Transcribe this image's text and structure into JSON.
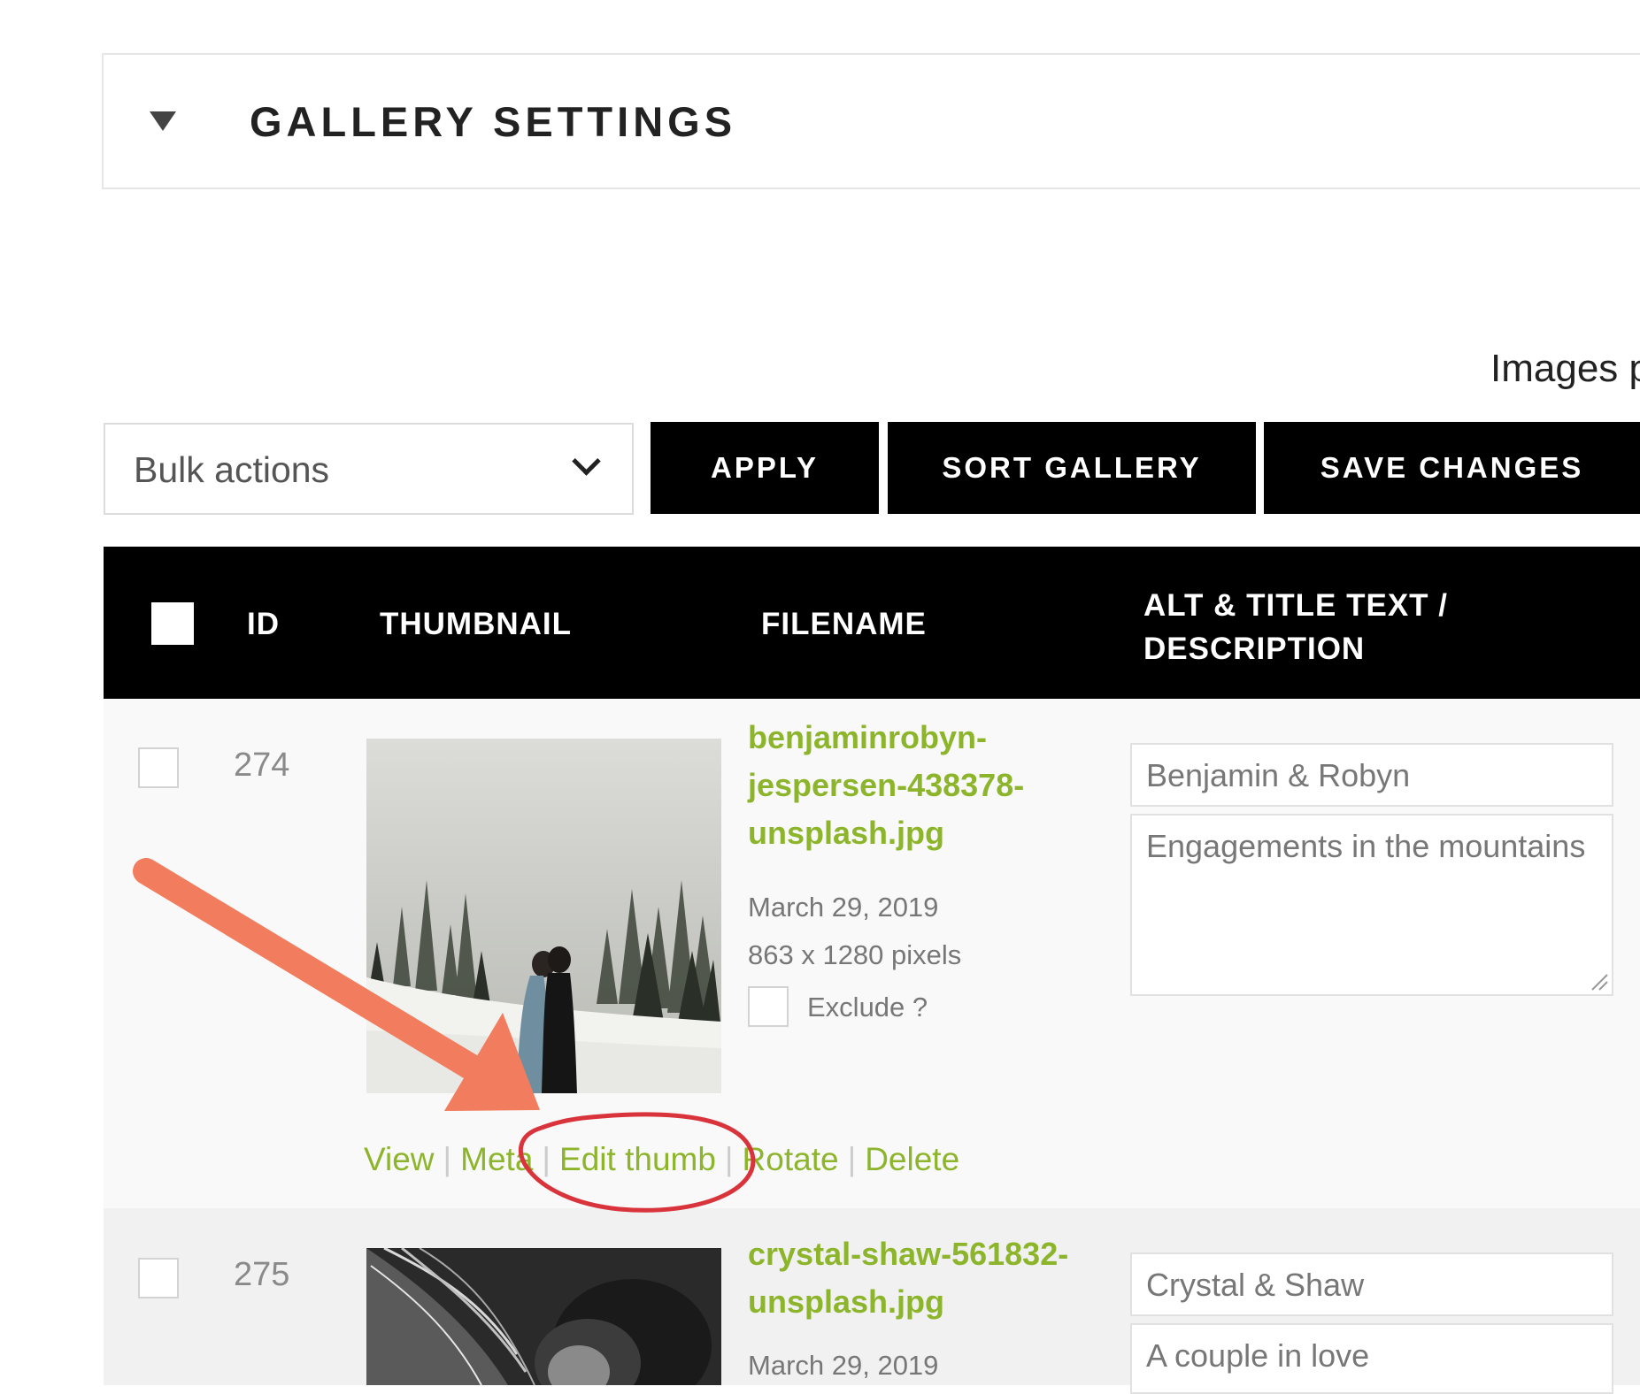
{
  "settings": {
    "title": "GALLERY SETTINGS"
  },
  "pagination": {
    "images_per_page_label": "Images p"
  },
  "toolbar": {
    "bulk_actions_label": "Bulk actions",
    "apply_label": "APPLY",
    "sort_label": "SORT GALLERY",
    "save_label": "SAVE CHANGES"
  },
  "table": {
    "headers": {
      "id": "ID",
      "thumbnail": "THUMBNAIL",
      "filename": "FILENAME",
      "alt_line1": "ALT & TITLE TEXT /",
      "alt_line2": "DESCRIPTION"
    },
    "rows": [
      {
        "id": "274",
        "filename_lines": [
          "benjaminrobyn-",
          "jespersen-438378-",
          "unsplash.jpg"
        ],
        "date": "March 29, 2019",
        "dimensions": "863 x 1280 pixels",
        "exclude_label": "Exclude ?",
        "alt_text": "Benjamin & Robyn",
        "description": "Engagements in the mountains",
        "actions": [
          "View",
          "Meta",
          "Edit thumb",
          "Rotate",
          "Delete"
        ]
      },
      {
        "id": "275",
        "filename_lines": [
          "crystal-shaw-561832-",
          "unsplash.jpg"
        ],
        "date": "March 29, 2019",
        "alt_text": "Crystal & Shaw",
        "description": "A couple in love"
      }
    ]
  },
  "colors": {
    "accent": "#8db52b",
    "annotation_arrow": "#f27d5e",
    "annotation_circle": "#d9343c"
  }
}
